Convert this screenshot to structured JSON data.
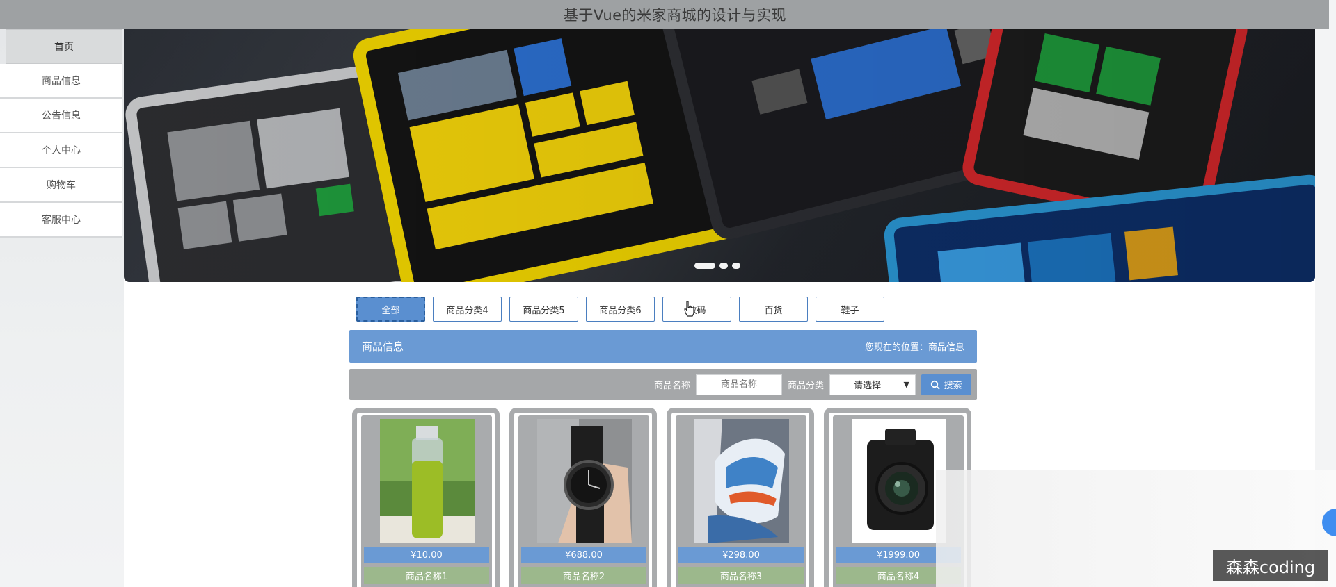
{
  "header": {
    "title": "基于Vue的米家商城的设计与实现"
  },
  "sidebar": {
    "items": [
      {
        "label": "首页"
      },
      {
        "label": "商品信息"
      },
      {
        "label": "公告信息"
      },
      {
        "label": "个人中心"
      },
      {
        "label": "购物车"
      },
      {
        "label": "客服中心"
      }
    ]
  },
  "categories": [
    {
      "label": "全部"
    },
    {
      "label": "商品分类4"
    },
    {
      "label": "商品分类5"
    },
    {
      "label": "商品分类6"
    },
    {
      "label": "数码"
    },
    {
      "label": "百货"
    },
    {
      "label": "鞋子"
    }
  ],
  "info_bar": {
    "title": "商品信息",
    "location": "您现在的位置：商品信息"
  },
  "search": {
    "name_label": "商品名称",
    "name_placeholder": "商品名称",
    "category_label": "商品分类",
    "category_selected": "请选择",
    "button_label": "搜索"
  },
  "products": [
    {
      "price": "¥10.00",
      "name": "商品名称1",
      "icon": "bottle-image"
    },
    {
      "price": "¥688.00",
      "name": "商品名称2",
      "icon": "watch-image"
    },
    {
      "price": "¥298.00",
      "name": "商品名称3",
      "icon": "sneaker-image"
    },
    {
      "price": "¥1999.00",
      "name": "商品名称4",
      "icon": "camera-image"
    }
  ],
  "watermark": "森森coding",
  "colors": {
    "accent": "#6a9ad4",
    "header_bg": "#9ea1a3",
    "name_bar": "#9cb88c"
  }
}
